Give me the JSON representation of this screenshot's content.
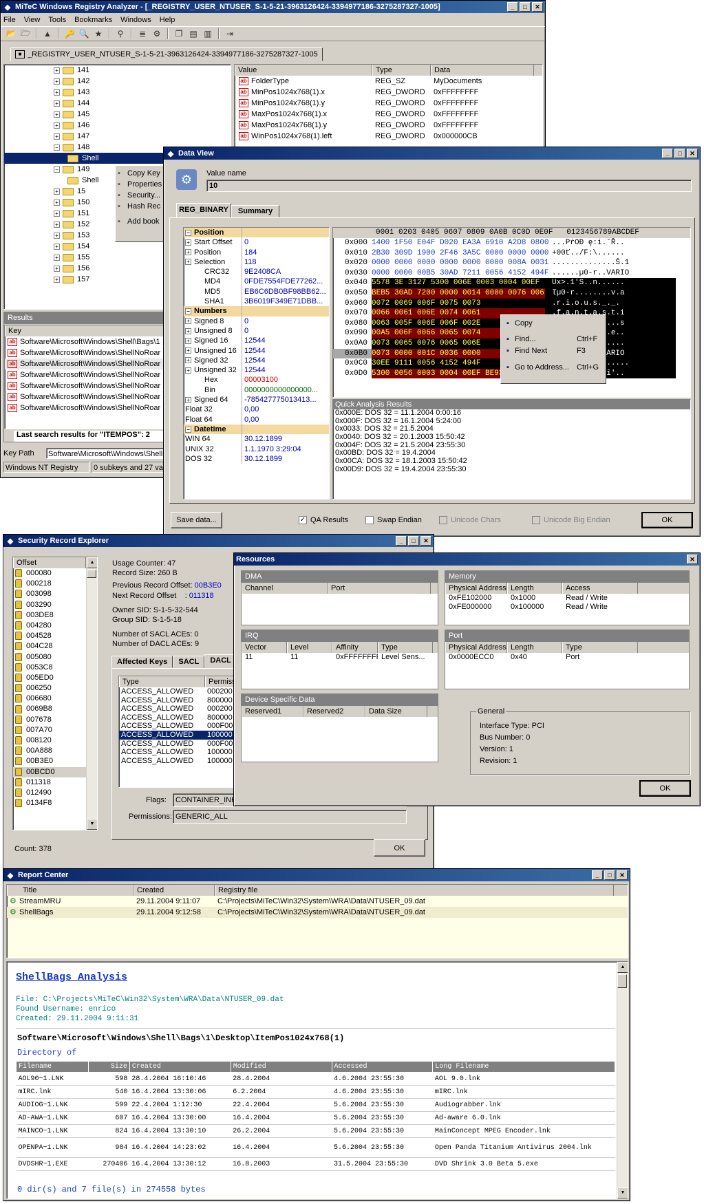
{
  "main": {
    "title": "MiTeC Windows Registry Analyzer - [_REGISTRY_USER_NTUSER_S-1-5-21-3963126424-3394977186-3275287327-1005]",
    "menu": [
      "File",
      "View",
      "Tools",
      "Bookmarks",
      "Windows",
      "Help"
    ],
    "tab": "_REGISTRY_USER_NTUSER_S-1-5-21-3963126424-3394977186-3275287327-1005",
    "tree": [
      "141",
      "142",
      "143",
      "144",
      "145",
      "146",
      "147",
      "148",
      "Shell",
      "149",
      "Shell",
      "15",
      "150",
      "151",
      "152",
      "153",
      "154",
      "155",
      "156",
      "157"
    ],
    "ctx": [
      "Copy Key",
      "Properties",
      "Security...",
      "Hash Rec",
      "Add book"
    ],
    "cols": {
      "value": "Value",
      "type": "Type",
      "data": "Data"
    },
    "values": [
      {
        "name": "FolderType",
        "type": "REG_SZ",
        "data": "MyDocuments"
      },
      {
        "name": "MinPos1024x768(1).x",
        "type": "REG_DWORD",
        "data": "0xFFFFFFFF"
      },
      {
        "name": "MinPos1024x768(1).y",
        "type": "REG_DWORD",
        "data": "0xFFFFFFFF"
      },
      {
        "name": "MaxPos1024x768(1).x",
        "type": "REG_DWORD",
        "data": "0xFFFFFFFF"
      },
      {
        "name": "MaxPos1024x768(1).y",
        "type": "REG_DWORD",
        "data": "0xFFFFFFFF"
      },
      {
        "name": "WinPos1024x768(1).left",
        "type": "REG_DWORD",
        "data": "0x000000CB"
      }
    ],
    "results": {
      "title": "Results",
      "key": "Key",
      "rows": [
        "Software\\Microsoft\\Windows\\Shell\\Bags\\1",
        "Software\\Microsoft\\Windows\\ShellNoRoar",
        "Software\\Microsoft\\Windows\\ShellNoRoar",
        "Software\\Microsoft\\Windows\\ShellNoRoar",
        "Software\\Microsoft\\Windows\\ShellNoRoar",
        "Software\\Microsoft\\Windows\\ShellNoRoar",
        "Software\\Microsoft\\Windows\\ShellNoRoar"
      ],
      "tab": "Last search results for \"ITEMPOS\": 2"
    },
    "status": {
      "keypath_label": "Key Path",
      "keypath": "Software\\Microsoft\\Windows\\ShellN",
      "source": "Windows NT Registry",
      "counts": "0 subkeys and 27 valu"
    }
  },
  "dataview": {
    "title": "Data View",
    "vname_label": "Value name",
    "vname": "10",
    "tabs": [
      "REG_BINARY",
      "Summary"
    ],
    "props": [
      {
        "k": "Position",
        "h": 1
      },
      {
        "k": "Start Offset",
        "v": "0",
        "p": 1
      },
      {
        "k": "Position",
        "v": "184",
        "p": 1
      },
      {
        "k": "Selection",
        "v": "118",
        "p": 1
      },
      {
        "k": "CRC32",
        "v": "9E2408CA",
        "i": 1
      },
      {
        "k": "MD4",
        "v": "0FDE7554FDE77262...",
        "i": 1
      },
      {
        "k": "MD5",
        "v": "EB6C6DB0BF98BB62...",
        "i": 1
      },
      {
        "k": "SHA1",
        "v": "3B6019F349E71DBB...",
        "i": 1
      },
      {
        "k": "Numbers",
        "h": 1
      },
      {
        "k": "Signed 8",
        "v": "0",
        "p": 1
      },
      {
        "k": "Unsigned 8",
        "v": "0",
        "p": 1
      },
      {
        "k": "Signed 16",
        "v": "12544",
        "p": 1
      },
      {
        "k": "Unsigned 16",
        "v": "12544",
        "p": 1
      },
      {
        "k": "Signed 32",
        "v": "12544",
        "p": 1
      },
      {
        "k": "Unsigned 32",
        "v": "12544",
        "p": 1
      },
      {
        "k": "Hex",
        "v": "00003100",
        "i": 1,
        "red": 1
      },
      {
        "k": "Bin",
        "v": "0000000000000000...",
        "i": 1,
        "green": 1
      },
      {
        "k": "Signed 64",
        "v": "-785427775013413...",
        "p": 1
      },
      {
        "k": "Float 32",
        "v": "0,00"
      },
      {
        "k": "Float 64",
        "v": "0,00"
      },
      {
        "k": "Datetime",
        "h": 1
      },
      {
        "k": "WIN 64",
        "v": "30.12.1899"
      },
      {
        "k": "UNIX 32",
        "v": "1.1.1970 3:29:04"
      },
      {
        "k": "DOS 32",
        "v": "30.12.1899"
      }
    ],
    "hexhdr": "0001 0203 0405 0607 0809 0A0B 0C0D 0E0F   0123456789ABCDEF",
    "hex": [
      {
        "o": "0x000",
        "h": "1400 1F50 E04F D020 EA3A 6910 A2D8 0800",
        "a": "...PŕOĐ ę:i.˘Ř.."
      },
      {
        "o": "0x010",
        "h": "2B30 309D 1900 2F46 3A5C 0000 0000 0000",
        "a": "+00ť../F:\\......"
      },
      {
        "o": "0x020",
        "h": "0000 0000 0000 0000 0000 0000 008A 0031",
        "a": "..............Š.1"
      },
      {
        "o": "0x030",
        "h": "0000 0000 00B5 30AD 7211 0056 4152 494F",
        "a": "......µ0-r..VARIO"
      },
      {
        "o": "0x040",
        "h": "5578 3E 3127 5300 006E 0003 0004 00EF",
        "a": "Ux>.1'S..n......"
      },
      {
        "o": "0x050",
        "h": "BEB5 30AD 7200 0000 0014 0000 0076 0061",
        "a": "ľµ0-r........v.a"
      },
      {
        "o": "0x060",
        "h": "0072 0069 006F 0075 0073",
        "a": ".r.i.o.u.s._._."
      },
      {
        "o": "0x070",
        "h": "0066 0061 006E 0074 0061",
        "a": ".f.a.n.t.a.s.t.i"
      },
      {
        "o": "0x080",
        "h": "0063 005F 006E 006F 002E",
        "a": ".c._.n.o.......s"
      },
      {
        "o": "0x090",
        "h": "00A5 006F 0066 0065 0074",
        "a": "...o.f.e.t.h.e.."
      },
      {
        "o": "0x0A0",
        "h": "0073 0065 0076 0065 006E",
        "a": ".s.e.v.e.n......"
      },
      {
        "o": "0x0B0",
        "h": "0073 0000 001C 0036 0000",
        "a": ".s.....6...VARIO"
      },
      {
        "o": "0x0C0",
        "h": "30EE 9111 0056 4152 494F",
        "a": "0î'..VARIO......."
      },
      {
        "o": "0x0D0",
        "h": "5300 0056 0003 0004 00EF BE93 30EE 9100",
        "a": "S..n......ž0î'.."
      }
    ],
    "hexctx": [
      "Copy",
      "Find...",
      "Ctrl+F",
      "Find Next",
      "F3",
      "Go to Address...",
      "Ctrl+G"
    ],
    "qa_title": "Quick Analysis Results",
    "qa": [
      "0x000E: DOS 32 = 11.1.2004 0:00:16",
      "0x000F: DOS 32 = 16.1.2004 5:24:00",
      "0x0033: DOS 32 = 21.5.2004",
      "0x0040: DOS 32 = 20.1.2003 15:50:42",
      "0x004F: DOS 32 = 21.5.2004 23:55:30",
      "0x00BD: DOS 32 = 19.4.2004",
      "0x00CA: DOS 32 = 18.1.2003 15:50:42",
      "0x00D9: DOS 32 = 19.4.2004 23:55:30"
    ],
    "save": "Save data...",
    "qa_cb": "QA Results",
    "swap": "Swap Endian",
    "uni": "Unicode Chars",
    "unibig": "Unicode Big Endian",
    "ok": "OK"
  },
  "security": {
    "title": "Security Record Explorer",
    "offset_col": "Offset",
    "offsets": [
      "000080",
      "000218",
      "003098",
      "003290",
      "003DE8",
      "004280",
      "004528",
      "004C28",
      "005080",
      "0053C8",
      "005ED0",
      "006250",
      "006680",
      "0069B8",
      "007678",
      "007A70",
      "008120",
      "00A888",
      "00B3E0",
      "00BCD0",
      "011318",
      "012490",
      "0134F8"
    ],
    "info": [
      "Usage Counter: 47",
      "Record Size: 260 B"
    ],
    "prev_label": "Previous Record Offset:",
    "prev": "00B3E0",
    "next_label": "Next Record Offset",
    "next": "011318",
    "sids": [
      "Owner SID: S-1-5-32-544",
      "Group SID: S-1-5-18"
    ],
    "aces": [
      "Number of SACL ACEs: 0",
      "Number of DACL ACEs: 9"
    ],
    "tabs": [
      "Affected Keys",
      "SACL",
      "DACL"
    ],
    "cols": [
      "Type",
      "Permiss"
    ],
    "rows": [
      [
        "ACCESS_ALLOWED",
        "000200"
      ],
      [
        "ACCESS_ALLOWED",
        "800000"
      ],
      [
        "ACCESS_ALLOWED",
        "000200"
      ],
      [
        "ACCESS_ALLOWED",
        "800000"
      ],
      [
        "ACCESS_ALLOWED",
        "000F00"
      ],
      [
        "ACCESS_ALLOWED",
        "100000"
      ],
      [
        "ACCESS_ALLOWED",
        "000F00"
      ],
      [
        "ACCESS_ALLOWED",
        "100000"
      ],
      [
        "ACCESS_ALLOWED",
        "100000"
      ]
    ],
    "flags_label": "Flags:",
    "flags": "CONTAINER_INHE",
    "perm_label": "Permissions:",
    "perm": "GENERIC_ALL",
    "count": "Count: 378",
    "ok": "OK"
  },
  "resources": {
    "title": "Resources",
    "dma": {
      "t": "DMA",
      "cols": [
        "Channel",
        "Port"
      ]
    },
    "mem": {
      "t": "Memory",
      "cols": [
        "Physical Address",
        "Length",
        "Access"
      ],
      "rows": [
        [
          "0xFE102000",
          "0x1000",
          "Read / Write"
        ],
        [
          "0xFE000000",
          "0x100000",
          "Read / Write"
        ]
      ]
    },
    "irq": {
      "t": "IRQ",
      "cols": [
        "Vector",
        "Level",
        "Affinity",
        "Type"
      ],
      "rows": [
        [
          "11",
          "11",
          "0xFFFFFFFF",
          "Level Sens..."
        ]
      ]
    },
    "port": {
      "t": "Port",
      "cols": [
        "Physical Address",
        "Length",
        "Type"
      ],
      "rows": [
        [
          "0x0000ECC0",
          "0x40",
          "Port"
        ]
      ]
    },
    "dsd": {
      "t": "Device Specific Data",
      "cols": [
        "Reserved1",
        "Reserved2",
        "Data Size"
      ]
    },
    "general": {
      "t": "General",
      "lines": [
        "Interface Type: PCI",
        "Bus Number: 0",
        "Version: 1",
        "Revision: 1"
      ]
    },
    "ok": "OK"
  },
  "report": {
    "title": "Report Center",
    "cols": [
      "Title",
      "Created",
      "Registry file"
    ],
    "rows": [
      [
        "StreamMRU",
        "29.11.2004 9:11:07",
        "C:\\Projects\\MiTeC\\Win32\\System\\WRA\\Data\\NTUSER_09.dat"
      ],
      [
        "ShellBags",
        "29.11.2004 9:12:58",
        "C:\\Projects\\MiTeC\\Win32\\System\\WRA\\Data\\NTUSER_09.dat"
      ]
    ],
    "heading": "ShellBags Analysis",
    "meta": [
      "File: C:\\Projects\\MiTeC\\Win32\\System\\WRA\\Data\\NTUSER_09.dat",
      "Found Username: enrico",
      "Created: 29.11.2004 9:11:31"
    ],
    "path": "Software\\Microsoft\\Windows\\Shell\\Bags\\1\\Desktop\\ItemPos1024x768(1)",
    "dir": "Directory of",
    "tcols": [
      "Filename",
      "Size",
      "Created",
      "Modified",
      "Accessed",
      "Long Filename"
    ],
    "trows": [
      [
        "AOL90~1.LNK",
        "598",
        "28.4.2004 16:10:46",
        "28.4.2004",
        "4.6.2004 23:55:30",
        "AOL 9.0.lnk"
      ],
      [
        "mIRC.lnk",
        "540",
        "16.4.2004 13:30:06",
        "6.2.2004",
        "4.6.2004 23:55:30",
        "mIRC.lnk"
      ],
      [
        "AUDIOG~1.LNK",
        "599",
        "22.4.2004 1:12:30",
        "22.4.2004",
        "5.6.2004 23:55:30",
        "Audiograbber.lnk"
      ],
      [
        "AD-AWA~1.LNK",
        "607",
        "16.4.2004 13:30:00",
        "16.4.2004",
        "5.6.2004 23:55:30",
        "Ad-aware 6.0.lnk"
      ],
      [
        "MAINCO~1.LNK",
        "824",
        "16.4.2004 13:30:10",
        "26.2.2004",
        "5.6.2004 23:55:30",
        "MainConcept MPEG Encoder.lnk"
      ],
      [
        "OPENPA~1.LNK",
        "984",
        "16.4.2004 14:23:02",
        "16.4.2004",
        "5.6.2004 23:55:30",
        "Open Panda Titanium Antivirus 2004.lnk"
      ],
      [
        "DVDSHR~1.EXE",
        "270406",
        "16.4.2004 13:30:12",
        "16.8.2003",
        "31.5.2004 23:55:30",
        "DVD Shrink 3.0 Beta 5.exe"
      ]
    ],
    "footer": "0 dir(s) and 7 file(s) in 274558 bytes"
  }
}
